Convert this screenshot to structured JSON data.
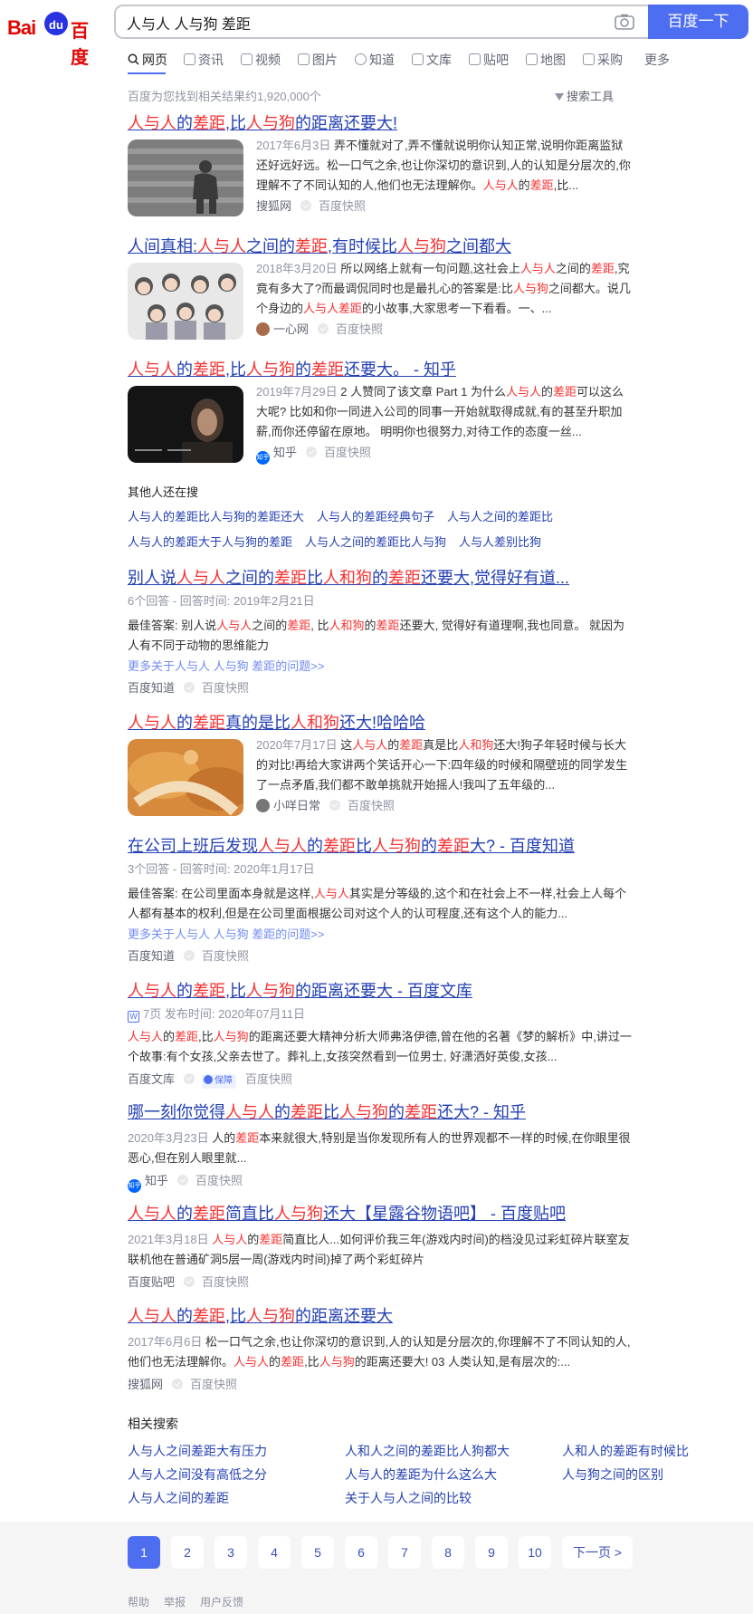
{
  "header": {
    "logo_ba": "Bai",
    "logo_du": "du",
    "logo_cn": "百度",
    "search_value": "人与人 人与狗 差距",
    "search_button": "百度一下",
    "camera_icon": "camera-icon"
  },
  "tabs": [
    "网页",
    "资讯",
    "视频",
    "图片",
    "知道",
    "文库",
    "贴吧",
    "地图",
    "采购",
    "更多"
  ],
  "result_count": "百度为您找到相关结果约1,920,000个",
  "search_tools": "搜索工具",
  "results": [
    {
      "title_parts": [
        [
          "人与人",
          1
        ],
        [
          "的",
          0
        ],
        [
          "差距",
          1
        ],
        [
          ",比",
          0
        ],
        [
          "人与狗",
          1
        ],
        [
          "的距离还要大!",
          0
        ]
      ],
      "abstract_parts": [
        [
          "2017年6月3日",
          2
        ],
        [
          " 弄不懂就对了,弄不懂就说明你认知正常,说明你距离监狱还好远好远。松一口气之余,也让你深切的意识到,人的认知是分层次的,你理解不了不同认知的人,他们也无法理解你。",
          0
        ],
        [
          "人与人",
          1
        ],
        [
          "的",
          0
        ],
        [
          "差距",
          1
        ],
        [
          ",比...",
          0
        ]
      ],
      "source": "搜狐网",
      "snapshot": "百度快照"
    },
    {
      "title_parts": [
        [
          "人间真相:",
          0
        ],
        [
          "人与人",
          1
        ],
        [
          "之间的",
          0
        ],
        [
          "差距",
          1
        ],
        [
          ",有时候比",
          0
        ],
        [
          "人与狗",
          1
        ],
        [
          "之间都大",
          0
        ]
      ],
      "abstract_parts": [
        [
          "2018年3月20日",
          2
        ],
        [
          " 所以网络上就有一句问题,这社会上",
          0
        ],
        [
          "人与人",
          1
        ],
        [
          "之间的",
          0
        ],
        [
          "差距",
          1
        ],
        [
          ",究竟有多大了?而最调侃同时也是最扎心的答案是:比",
          0
        ],
        [
          "人与狗",
          1
        ],
        [
          "之间都大。说几个身边的",
          0
        ],
        [
          "人与人差距",
          1
        ],
        [
          "的小故事,大家思考一下看看。一、...",
          0
        ]
      ],
      "source": "一心网",
      "snapshot": "百度快照"
    },
    {
      "title_parts": [
        [
          "人与人",
          1
        ],
        [
          "的",
          0
        ],
        [
          "差距",
          1
        ],
        [
          ",比",
          0
        ],
        [
          "人与狗",
          1
        ],
        [
          "的",
          0
        ],
        [
          "差距",
          1
        ],
        [
          "还要大。 - 知乎",
          0
        ]
      ],
      "abstract_parts": [
        [
          "2019年7月29日",
          2
        ],
        [
          " 2 人赞同了该文章 Part 1 为什么",
          0
        ],
        [
          "人与人",
          1
        ],
        [
          "的",
          0
        ],
        [
          "差距",
          1
        ],
        [
          "可以这么大呢? 比如和你一同进入公司的同事一开始就取得成就,有的甚至升职加薪,而你还停留在原地。 明明你也很努力,对待工作的态度一丝...",
          0
        ]
      ],
      "source": "知乎",
      "snapshot": "百度快照"
    }
  ],
  "others": {
    "heading": "其他人还在搜",
    "items": [
      "人与人的差距比人与狗的差距还大",
      "人与人的差距经典句子",
      "人与人之间的差距比",
      "人与人的差距大于人与狗的差距",
      "人与人之间的差距比人与狗",
      "人与人差别比狗"
    ]
  },
  "results2": [
    {
      "title_parts": [
        [
          "别人说",
          0
        ],
        [
          "人与人",
          1
        ],
        [
          "之间的",
          0
        ],
        [
          "差距",
          1
        ],
        [
          "比",
          0
        ],
        [
          "人和狗",
          1
        ],
        [
          "的",
          0
        ],
        [
          "差距",
          1
        ],
        [
          "还要大,觉得好有道...",
          0
        ]
      ],
      "meta": "6个回答 - 回答时间: 2019年2月21日",
      "abstract_parts": [
        [
          "最佳答案: 别人说",
          0
        ],
        [
          "人与人",
          1
        ],
        [
          "之间的",
          0
        ],
        [
          "差距",
          1
        ],
        [
          ", 比",
          0
        ],
        [
          "人和狗",
          1
        ],
        [
          "的",
          0
        ],
        [
          "差距",
          1
        ],
        [
          "还要大, 觉得好有道理啊,我也同意。 就因为人有不同于动物的思维能力",
          0
        ]
      ],
      "more": "更多关于人与人 人与狗 差距的问题>>",
      "source": "百度知道",
      "snapshot": "百度快照"
    },
    {
      "title_parts": [
        [
          "人与人",
          1
        ],
        [
          "的",
          0
        ],
        [
          "差距",
          1
        ],
        [
          "真的是比",
          0
        ],
        [
          "人和狗",
          1
        ],
        [
          "还大!哈哈哈",
          0
        ]
      ],
      "abstract_parts": [
        [
          "2020年7月17日",
          2
        ],
        [
          " 这",
          0
        ],
        [
          "人与人",
          1
        ],
        [
          "的",
          0
        ],
        [
          "差距",
          1
        ],
        [
          "真是比",
          0
        ],
        [
          "人和狗",
          1
        ],
        [
          "还大!狗子年轻时候与长大的对比!再给大家讲两个笑话开心一下:四年级的时候和隔壁班的同学发生了一点矛盾,我们都不敢单挑就开始摇人!我叫了五年级的...",
          0
        ]
      ],
      "source": "小咩日常",
      "snapshot": "百度快照"
    },
    {
      "title_parts": [
        [
          "在公司上班后发现",
          0
        ],
        [
          "人与人",
          1
        ],
        [
          "的",
          0
        ],
        [
          "差距",
          1
        ],
        [
          "比",
          0
        ],
        [
          "人与狗",
          1
        ],
        [
          "的",
          0
        ],
        [
          "差距",
          1
        ],
        [
          "大? - 百度知道",
          0
        ]
      ],
      "meta": "3个回答 - 回答时间: 2020年1月17日",
      "abstract_parts": [
        [
          "最佳答案: 在公司里面本身就是这样,",
          0
        ],
        [
          "人与人",
          1
        ],
        [
          "其实是分等级的,这个和在社会上不一样,社会上人每个人都有基本的权利,但是在公司里面根据公司对这个人的认可程度,还有这个人的能力...",
          0
        ]
      ],
      "more": "更多关于人与人 人与狗 差距的问题>>",
      "source": "百度知道",
      "snapshot": "百度快照"
    },
    {
      "title_parts": [
        [
          "人与人",
          1
        ],
        [
          "的",
          0
        ],
        [
          "差距",
          1
        ],
        [
          ",比",
          0
        ],
        [
          "人与狗",
          1
        ],
        [
          "的距离还要大 - 百度文库",
          0
        ]
      ],
      "meta": "7页 发布时间: 2020年07月11日",
      "abstract_parts": [
        [
          "人与人",
          1
        ],
        [
          "的",
          0
        ],
        [
          "差距",
          1
        ],
        [
          ",比",
          0
        ],
        [
          "人与狗",
          1
        ],
        [
          "的距离还要大精神分析大师弗洛伊德,曾在他的名著《梦的解析》中,讲过一个故事:有个女孩,父亲去世了。葬礼上,女孩突然看到一位男士, 好潇洒好英俊,女孩...",
          0
        ]
      ],
      "source": "百度文库",
      "badge": "保障",
      "snapshot": "百度快照"
    },
    {
      "title_parts": [
        [
          "哪一刻你觉得",
          0
        ],
        [
          "人与人",
          1
        ],
        [
          "的",
          0
        ],
        [
          "差距",
          1
        ],
        [
          "比",
          0
        ],
        [
          "人与狗",
          1
        ],
        [
          "的",
          0
        ],
        [
          "差距",
          1
        ],
        [
          "还大? - 知乎",
          0
        ]
      ],
      "abstract_parts": [
        [
          "2020年3月23日",
          2
        ],
        [
          " 人的",
          0
        ],
        [
          "差距",
          1
        ],
        [
          "本来就很大,特别是当你发现所有人的世界观都不一样的时候,在你眼里很恶心,但在别人眼里就...",
          0
        ]
      ],
      "source": "知乎",
      "snapshot": "百度快照"
    },
    {
      "title_parts": [
        [
          "人与人",
          1
        ],
        [
          "的",
          0
        ],
        [
          "差距",
          1
        ],
        [
          "简直比",
          0
        ],
        [
          "人与狗",
          1
        ],
        [
          "还大【星露谷物语吧】 - 百度贴吧",
          0
        ]
      ],
      "abstract_parts": [
        [
          "2021年3月18日",
          2
        ],
        [
          " ",
          0
        ],
        [
          "人与人",
          1
        ],
        [
          "的",
          0
        ],
        [
          "差距",
          1
        ],
        [
          "简直比人...如何评价我三年(游戏内时间)的档没见过彩虹碎片联室友联机他在普通矿洞5层一周(游戏内时间)掉了两个彩虹碎片",
          0
        ]
      ],
      "source": "百度贴吧",
      "snapshot": "百度快照"
    },
    {
      "title_parts": [
        [
          "人与人",
          1
        ],
        [
          "的",
          0
        ],
        [
          "差距",
          1
        ],
        [
          ",比",
          0
        ],
        [
          "人与狗",
          1
        ],
        [
          "的距离还要大",
          0
        ]
      ],
      "abstract_parts": [
        [
          "2017年6月6日",
          2
        ],
        [
          " 松一口气之余,也让你深切的意识到,人的认知是分层次的,你理解不了不同认知的人,他们也无法理解你。",
          0
        ],
        [
          "人与人",
          1
        ],
        [
          "的",
          0
        ],
        [
          "差距",
          1
        ],
        [
          ",比",
          0
        ],
        [
          "人与狗",
          1
        ],
        [
          "的距离还要大! 03 人类认知,是有层次的:...",
          0
        ]
      ],
      "source": "搜狐网",
      "snapshot": "百度快照"
    }
  ],
  "related": {
    "heading": "相关搜索",
    "items": [
      "人与人之间差距大有压力",
      "人和人之间的差距比人狗都大",
      "人和人的差距有时候比",
      "人与人之间没有高低之分",
      "人与人的差距为什么这么大",
      "人与狗之间的区别",
      "人与人之间的差距",
      "关于人与人之间的比较"
    ]
  },
  "pager": {
    "pages": [
      "1",
      "2",
      "3",
      "4",
      "5",
      "6",
      "7",
      "8",
      "9",
      "10"
    ],
    "next": "下一页 >"
  },
  "footer": [
    "帮助",
    "举报",
    "用户反馈"
  ],
  "colors": {
    "accent": "#4e6ef2",
    "link": "#2440b3",
    "highlight": "#f73131",
    "logo_red": "#e10602",
    "logo_blue": "#2932e1"
  }
}
